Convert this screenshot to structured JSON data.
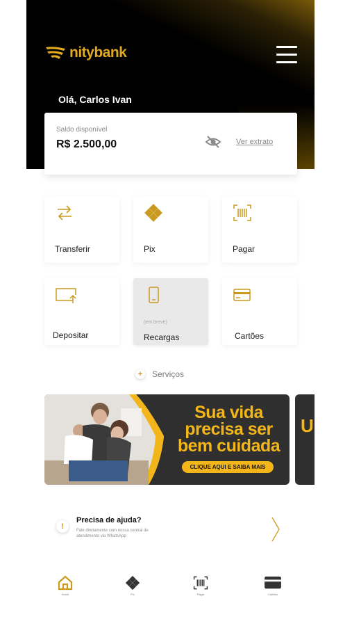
{
  "brand": {
    "name": "nitybank",
    "accent": "#e3aa1f"
  },
  "header": {
    "greeting": "Olá, Carlos Ivan",
    "menu_icon": "hamburger-menu-icon"
  },
  "balance": {
    "label": "Saldo disponível",
    "value": "R$ 2.500,00",
    "hide_icon": "eye-off-icon",
    "statement_link": "Ver extrato"
  },
  "actions": [
    {
      "label": "Transferir",
      "icon": "transfer-arrows-icon"
    },
    {
      "label": "Pix",
      "icon": "pix-icon"
    },
    {
      "label": "Pagar",
      "icon": "barcode-icon"
    },
    {
      "label": "Depositar",
      "icon": "deposit-icon"
    },
    {
      "label": "Recargas",
      "icon": "phone-icon",
      "badge": "(em breve)"
    },
    {
      "label": "Cartões",
      "icon": "card-icon"
    }
  ],
  "services": {
    "label": "Serviços",
    "icon": "plus-icon"
  },
  "banner": {
    "line1": "Sua vida",
    "line2": "precisa ser",
    "line3": "bem cuidada",
    "cta": "CLIQUE AQUI E SAIBA MAIS",
    "next_letter": "U"
  },
  "help": {
    "icon": "alert-icon",
    "title": "Precisa de ajuda?",
    "subtitle": "Fale diretamente com nossa central de atendimento via WhatsApp"
  },
  "nav": [
    {
      "label": "Home",
      "icon": "home-icon"
    },
    {
      "label": "Pix",
      "icon": "pix-icon"
    },
    {
      "label": "Pagar",
      "icon": "barcode-icon"
    },
    {
      "label": "Cartões",
      "icon": "card-icon"
    }
  ]
}
